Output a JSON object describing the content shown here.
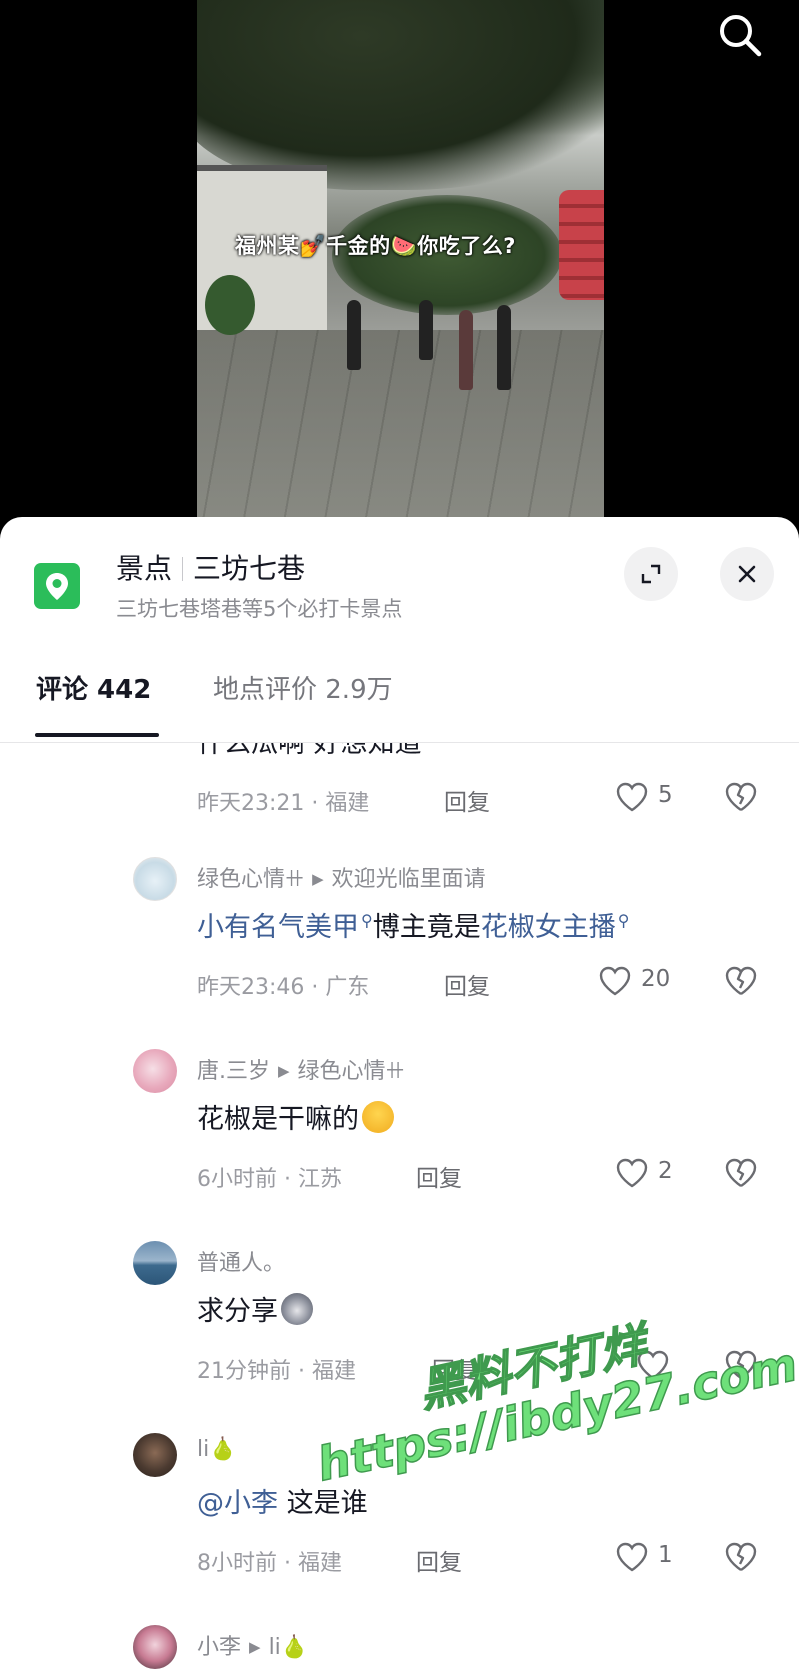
{
  "video": {
    "caption": "福州某💅千金的🍉你吃了么?"
  },
  "location": {
    "category": "景点",
    "name": "三坊七巷",
    "subtitle": "三坊七巷塔巷等5个必打卡景点"
  },
  "tabs": {
    "comments_label": "评论 442",
    "reviews_label": "地点评价 2.9万"
  },
  "comments": [
    {
      "text_partial": "什么瓜啊 好想知道",
      "meta": "昨天23:21 · 福建",
      "reply": "回复",
      "likes": "5"
    },
    {
      "author": "绿色心情ꔠ",
      "reply_to": "欢迎光临里面请",
      "link1": "小有名气美甲",
      "middle": "博主竟是",
      "link2": "花椒女主播",
      "meta": "昨天23:46 · 广东",
      "reply": "回复",
      "likes": "20"
    },
    {
      "author": "唐.三岁",
      "reply_to": "绿色心情ꔠ",
      "text": "花椒是干嘛的",
      "meta": "6小时前 · 江苏",
      "reply": "回复",
      "likes": "2"
    },
    {
      "author": "普通人。",
      "text": "求分享",
      "meta": "21分钟前 · 福建",
      "reply": "回复",
      "likes": ""
    },
    {
      "author": "li🍐",
      "mention": "@小李",
      "text": " 这是谁",
      "meta": "8小时前 · 福建",
      "reply": "回复",
      "likes": "1"
    },
    {
      "author": "小李",
      "reply_to": "li🍐"
    }
  ],
  "watermark": {
    "line1": "黑料不打烊",
    "line2": "https://ibdy27.com"
  }
}
